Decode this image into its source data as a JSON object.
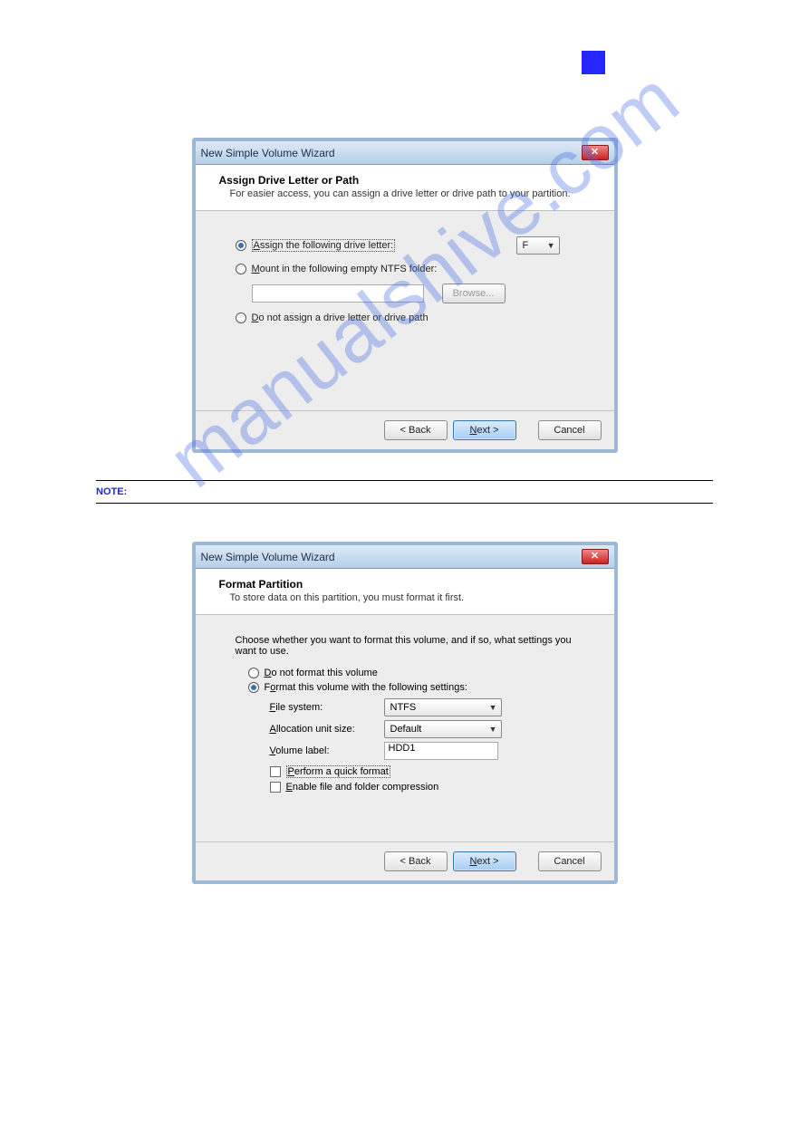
{
  "page": {
    "number": "",
    "header_right": ""
  },
  "step7": "",
  "note": {
    "label": "NOTE:",
    "text": ""
  },
  "step8": "",
  "watermark": "manualshive.com",
  "dialog1": {
    "title": "New Simple Volume Wizard",
    "banner_title": "Assign Drive Letter or Path",
    "banner_sub": "For easier access, you can assign a drive letter or drive path to your partition.",
    "opt_assign": "Assign the following drive letter:",
    "drive_letter": "F",
    "opt_mount": "Mount in the following empty NTFS folder:",
    "browse": "Browse...",
    "opt_none": "Do not assign a drive letter or drive path",
    "back": "< Back",
    "next": "Next >",
    "cancel": "Cancel"
  },
  "dialog2": {
    "title": "New Simple Volume Wizard",
    "banner_title": "Format Partition",
    "banner_sub": "To store data on this partition, you must format it first.",
    "intro": "Choose whether you want to format this volume, and if so, what settings you want to use.",
    "opt_noformat": "Do not format this volume",
    "opt_format": "Format this volume with the following settings:",
    "fs_label": "File system:",
    "fs_value": "NTFS",
    "au_label": "Allocation unit size:",
    "au_value": "Default",
    "vl_label": "Volume label:",
    "vl_value": "HDD1",
    "quick": "Perform a quick format",
    "compress": "Enable file and folder compression",
    "back": "< Back",
    "next": "Next >",
    "cancel": "Cancel"
  }
}
